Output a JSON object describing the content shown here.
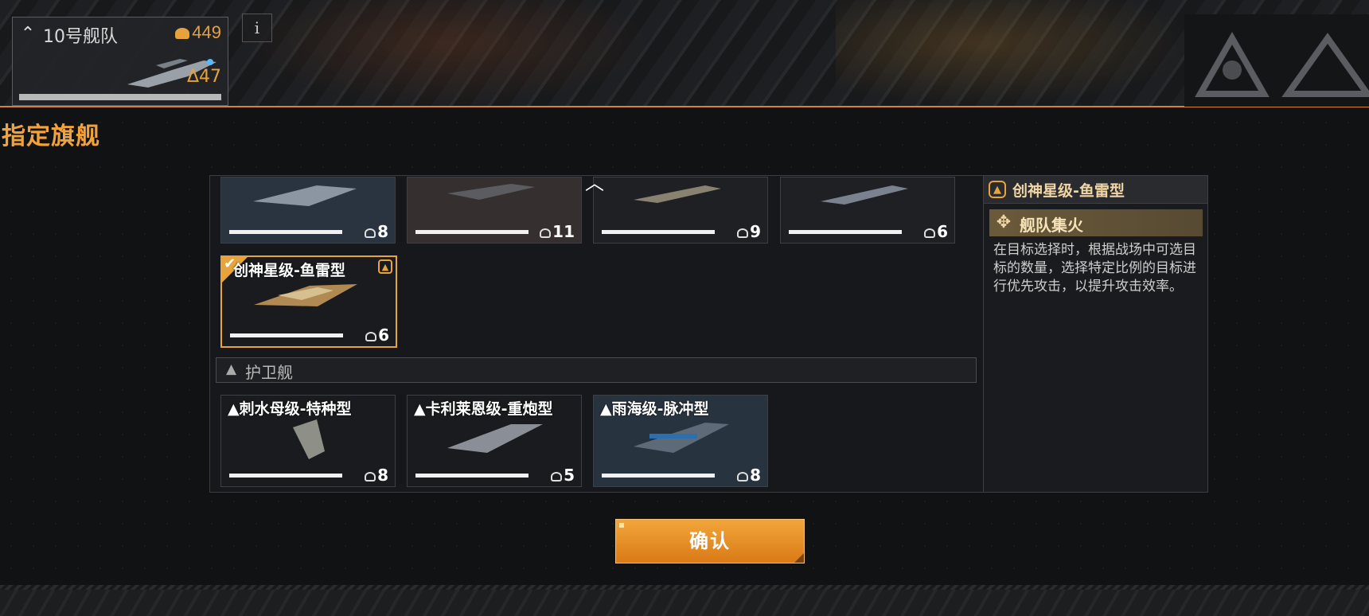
{
  "header": {
    "fleet_name": "10号舰队",
    "power_value": "449",
    "delta_value": "Δ47",
    "info_label": "i"
  },
  "page_title": "指定旗舰",
  "top_row_ships": [
    {
      "cost": "8"
    },
    {
      "cost": "11"
    },
    {
      "cost": "9"
    },
    {
      "cost": "6"
    }
  ],
  "selected_ship": {
    "name": "创神星级-鱼雷型",
    "cost": "6",
    "check": "✔",
    "rank": "▲"
  },
  "escort_section": {
    "label": "护卫舰",
    "marker": "▲"
  },
  "escort_ships": [
    {
      "name": "▲刺水母级-特种型",
      "cost": "8"
    },
    {
      "name": "▲卡利莱恩级-重炮型",
      "cost": "5"
    },
    {
      "name": "▲雨海级-脉冲型",
      "cost": "8"
    }
  ],
  "detail": {
    "ship_name": "创神星级-鱼雷型",
    "skill_name": "舰队集火",
    "skill_description": "在目标选择时，根据战场中可选目标的数量，选择特定比例的目标进行优先攻击，以提升攻击效率。"
  },
  "confirm_label": "确认",
  "colors": {
    "accent": "#e8a43c",
    "confirm": "#e8901f",
    "panel_bg": "#17181b"
  }
}
